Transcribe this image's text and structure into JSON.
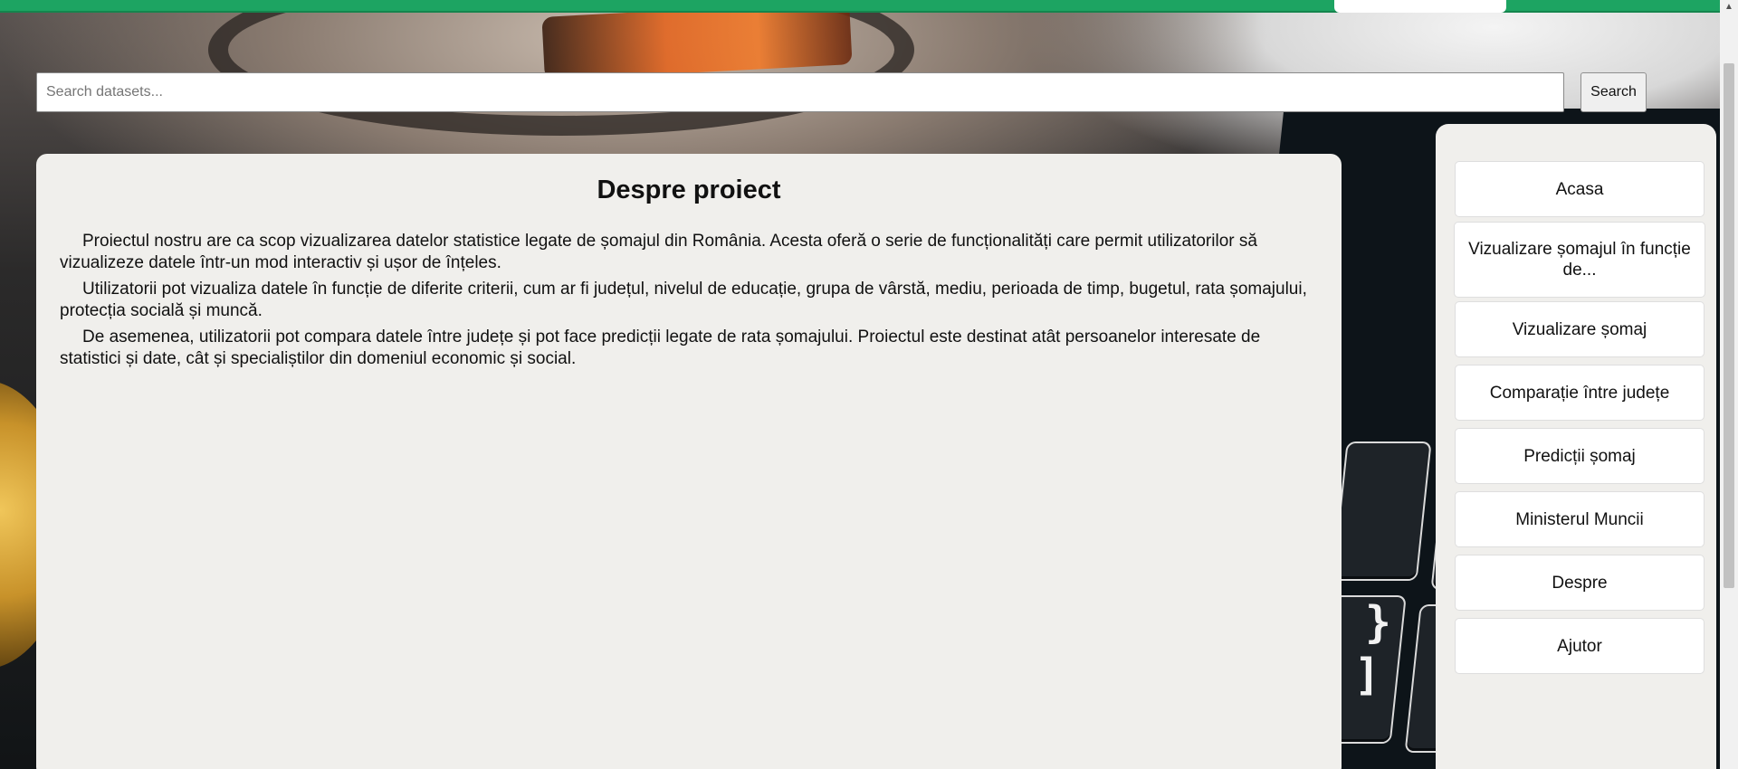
{
  "search": {
    "placeholder": "Search datasets...",
    "button_label": "Search"
  },
  "main": {
    "title": "Despre proiect",
    "paragraphs": [
      "Proiectul nostru are ca scop vizualizarea datelor statistice legate de șomajul din România. Acesta oferă o serie de funcționalități care permit utilizatorilor să vizualizeze datele într-un mod interactiv și ușor de înțeles.",
      "Utilizatorii pot vizualiza datele în funcție de diferite criterii, cum ar fi județul, nivelul de educație, grupa de vârstă, mediu, perioada de timp, bugetul, rata șomajului, protecția socială și muncă.",
      "De asemenea, utilizatorii pot compara datele între județe și pot face predicții legate de rata șomajului. Proiectul este destinat atât persoanelor interesate de statistici și date, cât și specialiștilor din domeniul economic și social."
    ]
  },
  "sidebar": {
    "items": [
      {
        "label": "Acasa"
      },
      {
        "label": "Vizualizare șomajul în funcție de..."
      },
      {
        "label": "Vizualizare șomaj"
      },
      {
        "label": "Comparație între județe"
      },
      {
        "label": "Predicții șomaj"
      },
      {
        "label": "Ministerul Muncii"
      },
      {
        "label": "Despre"
      },
      {
        "label": "Ajutor"
      }
    ]
  },
  "colors": {
    "top_bar": "#1da462",
    "panel_bg": "#f0efec"
  },
  "icons": {
    "scroll_up": "▲"
  }
}
